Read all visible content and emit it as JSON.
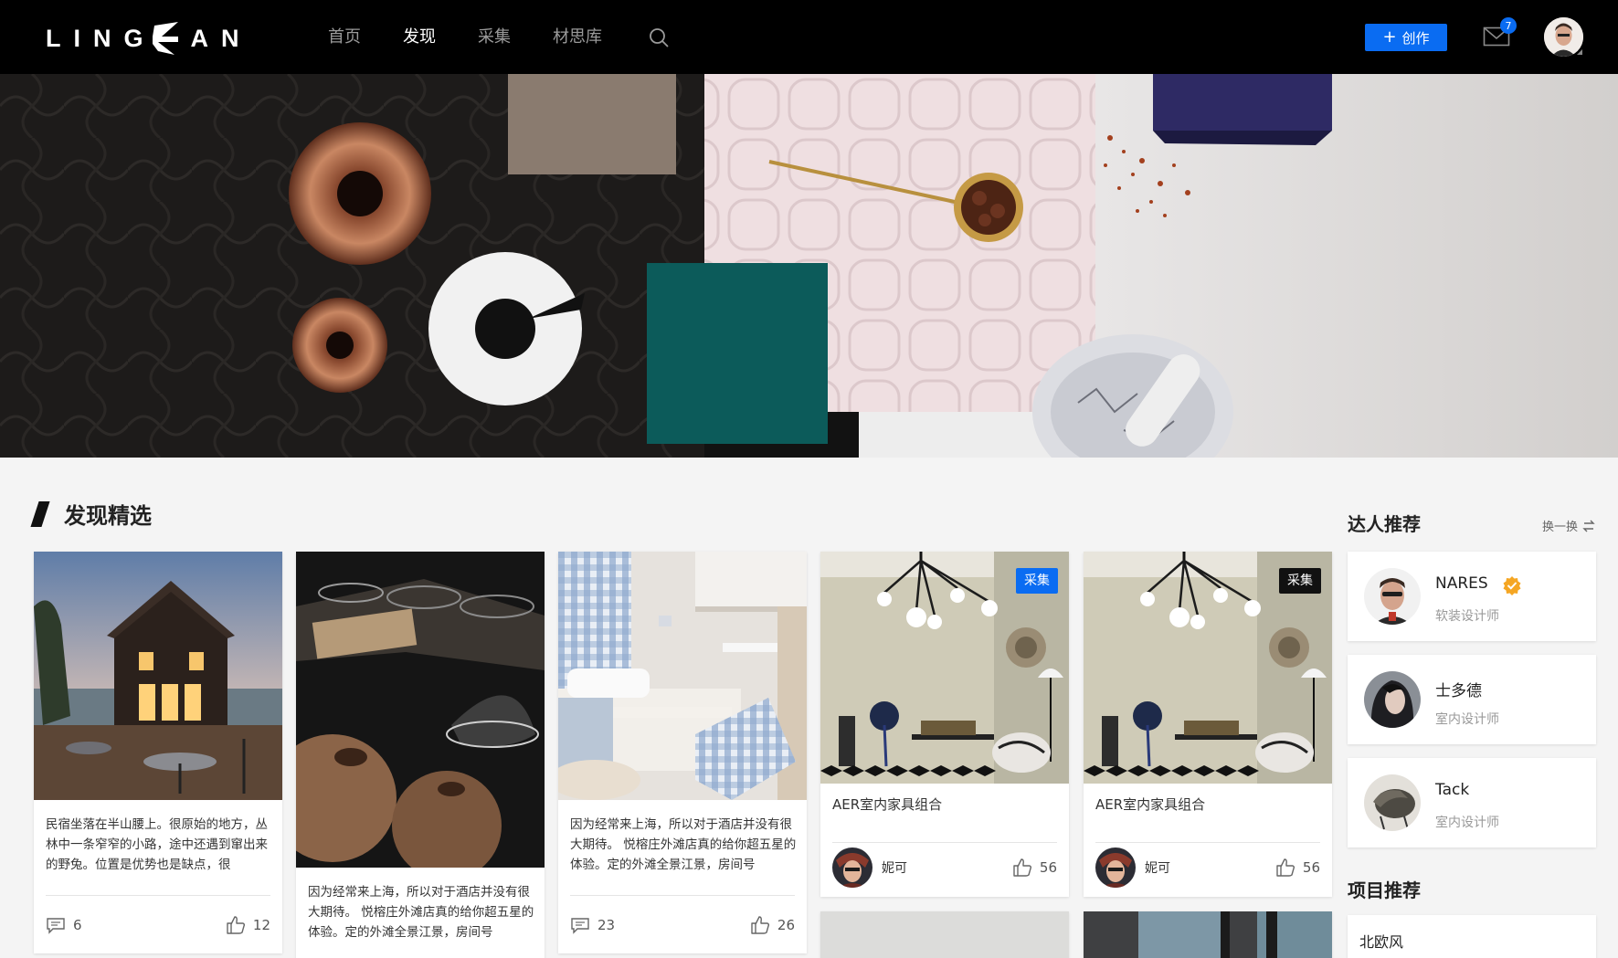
{
  "header": {
    "logo_text": "LINGDAN",
    "nav": [
      {
        "label": "首页",
        "active": false
      },
      {
        "label": "发现",
        "active": true
      },
      {
        "label": "采集",
        "active": false
      },
      {
        "label": "材思库",
        "active": false
      }
    ],
    "create_label": "创作",
    "create_icon": "plus-icon",
    "mail_icon": "mail-icon",
    "mail_badge": "7",
    "accent_color": "#0a6cf2"
  },
  "hero": {
    "image": "material-flatlay-banner"
  },
  "section": {
    "title": "发现精选"
  },
  "cards": [
    {
      "type": "post",
      "image": "night-house-patio",
      "description": "民宿坐落在半山腰上。很原始的地方，丛林中一条窄窄的小路，途中还遇到窜出来的野兔。位置是优势也是缺点，很",
      "comments": "6",
      "likes": "12"
    },
    {
      "type": "post",
      "image": "glassware-wooden-spheres",
      "description": "因为经常来上海，所以对于酒店并没有很大期待。 悦榕庄外滩店真的给你超五星的体验。定的外滩全景江景，房间号"
    },
    {
      "type": "post",
      "image": "kids-room-blue-plaid",
      "description": "因为经常来上海，所以对于酒店并没有很大期待。 悦榕庄外滩店真的给你超五星的体验。定的外滩全景江景，房间号",
      "comments": "23",
      "likes": "26"
    },
    {
      "type": "collection",
      "image": "living-room-chandelier",
      "tag": "采集",
      "tag_color": "#0a6cf2",
      "title": "AER室内家具组合",
      "author": "妮可",
      "likes": "56"
    },
    {
      "type": "collection",
      "image": "living-room-chandelier",
      "tag": "采集",
      "tag_color": "#111111",
      "title": "AER室内家具组合",
      "author": "妮可",
      "likes": "56"
    }
  ],
  "sidebar": {
    "experts_title": "达人推荐",
    "refresh_label": "换一换",
    "refresh_icon": "swap-icon",
    "experts": [
      {
        "name": "NARES",
        "role": "软装设计师",
        "verified": true
      },
      {
        "name": "士多德",
        "role": "室内设计师",
        "verified": false
      },
      {
        "name": "Tack",
        "role": "室内设计师",
        "verified": false
      }
    ],
    "projects_title": "项目推荐",
    "projects": [
      {
        "label": "北欧风"
      }
    ]
  }
}
